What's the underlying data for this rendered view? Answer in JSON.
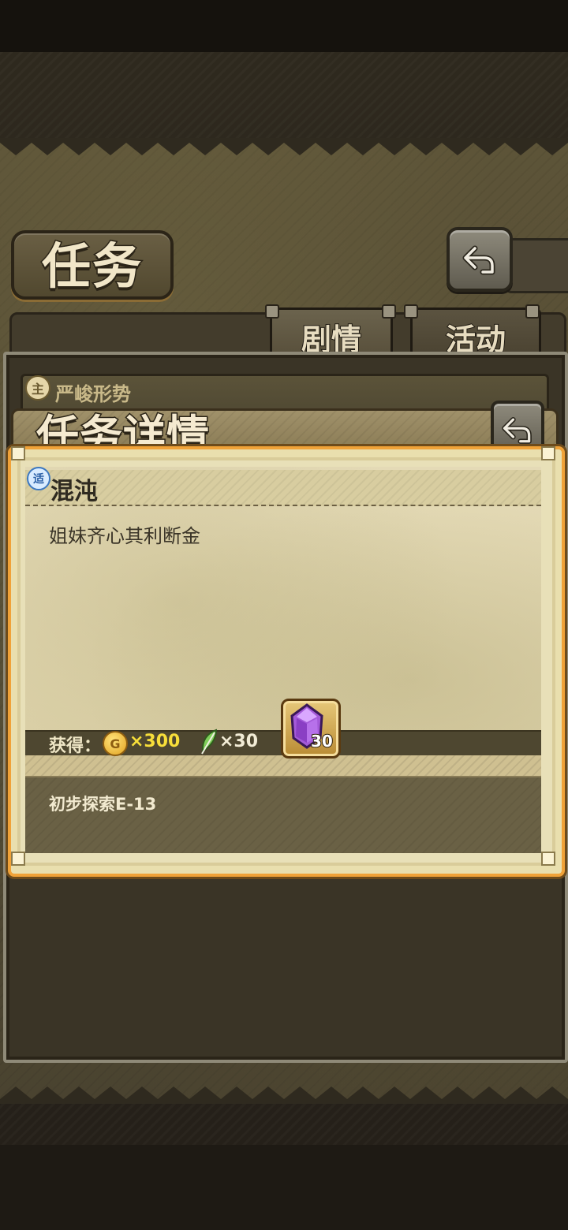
{
  "screen": {
    "title": "任务",
    "tabs": [
      {
        "label": "剧情",
        "active": true
      },
      {
        "label": "活动",
        "active": false
      }
    ]
  },
  "list": {
    "items": [
      {
        "badge": "主",
        "title": "严峻形势"
      }
    ]
  },
  "dialog": {
    "title": "任务详情",
    "mission": {
      "badge": "适",
      "name": "混沌",
      "description": "姐妹齐心其利断金"
    },
    "rewards": {
      "label": "获得：",
      "coin_icon_letter": "G",
      "coin_amount": "×300",
      "feather_amount": "×30",
      "crystal_count": "30"
    },
    "objective": "初步探索E-13"
  },
  "colors": {
    "accent_orange": "#f0a238",
    "coin_yellow": "#f7de3a",
    "crystal_purple": "#a45ad8"
  }
}
